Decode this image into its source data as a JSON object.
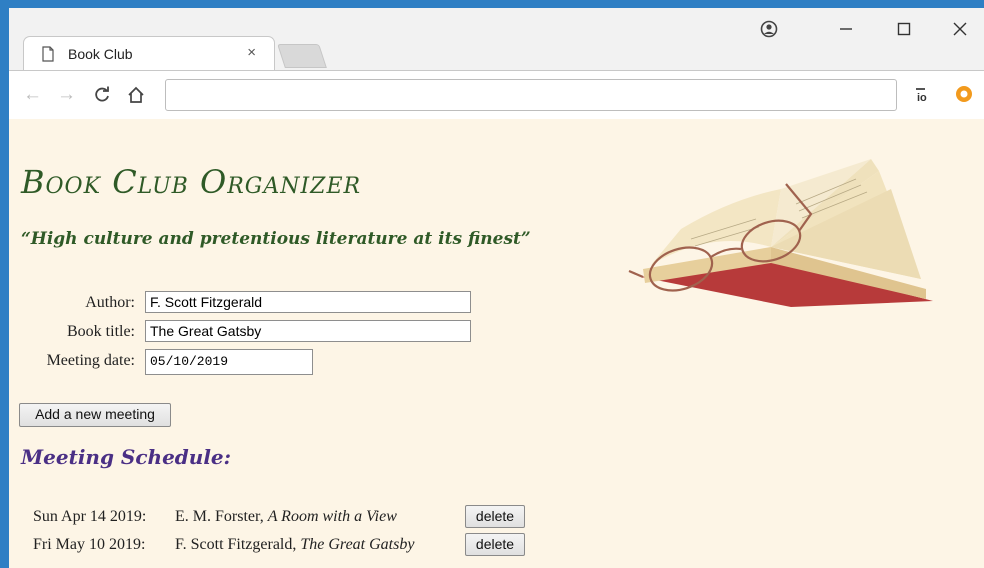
{
  "browser": {
    "tab_title": "Book Club",
    "tab_close": "×",
    "address": "",
    "colors": {
      "frame": "#f2f2f2",
      "accent_bg": "#2f7fc4"
    }
  },
  "page": {
    "title": "Book Club Organizer",
    "tagline": "“High culture and pretentious literature at its finest”",
    "form": {
      "author_label": "Author:",
      "author_value": "F. Scott Fitzgerald",
      "book_label": "Book title:",
      "book_value": "The Great Gatsby",
      "date_label": "Meeting date:",
      "date_value": "05/10/2019"
    },
    "add_button": "Add a new meeting",
    "schedule_heading": "Meeting Schedule:",
    "meetings": [
      {
        "date": "Sun Apr 14 2019:",
        "author": "E. M. Forster,",
        "book": "A Room with a View",
        "delete_label": "delete"
      },
      {
        "date": "Fri May 10 2019:",
        "author": "F. Scott Fitzgerald,",
        "book": "The Great Gatsby",
        "delete_label": "delete"
      }
    ],
    "colors": {
      "background": "#fdf5e6",
      "title": "#2f5a27",
      "heading": "#4a2f85"
    }
  }
}
